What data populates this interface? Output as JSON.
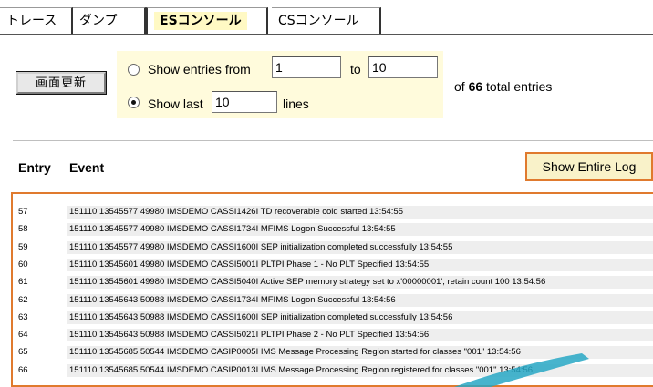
{
  "tabs": [
    {
      "label": "トレース",
      "active": false
    },
    {
      "label": "ダンプ",
      "active": false
    },
    {
      "label": "ESコンソール",
      "active": true
    },
    {
      "label": "CSコンソール",
      "active": false
    }
  ],
  "controls": {
    "refresh_label": "画面更新",
    "show_entries_from_label": "Show entries from",
    "from_value": "1",
    "to_label": "to",
    "to_value": "10",
    "show_last_label": "Show last",
    "last_value": "10",
    "lines_label": "lines",
    "selected_mode": "show_last",
    "total_prefix": "of",
    "total_count": "66",
    "total_suffix": "total entries"
  },
  "header": {
    "entry_col": "Entry",
    "event_col": "Event",
    "show_log_label": "Show Entire Log"
  },
  "log": [
    {
      "entry": "57",
      "event": "151110 13545577 49980 IMSDEMO CASSI1426I TD recoverable cold started 13:54:55"
    },
    {
      "entry": "58",
      "event": "151110 13545577 49980 IMSDEMO CASSI1734I MFIMS Logon Successful 13:54:55"
    },
    {
      "entry": "59",
      "event": "151110 13545577 49980 IMSDEMO CASSI1600I SEP initialization completed successfully 13:54:55"
    },
    {
      "entry": "60",
      "event": "151110 13545601 49980 IMSDEMO CASSI5001I PLTPI Phase 1 - No PLT Specified 13:54:55"
    },
    {
      "entry": "61",
      "event": "151110 13545601 49980 IMSDEMO CASSI5040I Active SEP memory strategy set to x'00000001', retain count 100 13:54:56"
    },
    {
      "entry": "62",
      "event": "151110 13545643 50988 IMSDEMO CASSI1734I MFIMS Logon Successful 13:54:56"
    },
    {
      "entry": "63",
      "event": "151110 13545643 50988 IMSDEMO CASSI1600I SEP initialization completed successfully 13:54:56"
    },
    {
      "entry": "64",
      "event": "151110 13545643 50988 IMSDEMO CASSI5021I PLTPI Phase 2 - No PLT Specified 13:54:56"
    },
    {
      "entry": "65",
      "event": "151110 13545685 50544 IMSDEMO CASIP0005I IMS Message Processing Region started for classes \"001\" 13:54:56"
    },
    {
      "entry": "66",
      "event": "151110 13545685 50544 IMSDEMO CASIP0013I IMS Message Processing Region registered for classes \"001\" 13:54:56"
    }
  ],
  "colors": {
    "accent_orange": "#e07a2e",
    "filter_bg": "#fffbdc",
    "tab_highlight": "#fff9c4",
    "button_bg": "#f9f2c9",
    "row_bg": "#eeeeee",
    "swoosh": "#27a7c4"
  }
}
